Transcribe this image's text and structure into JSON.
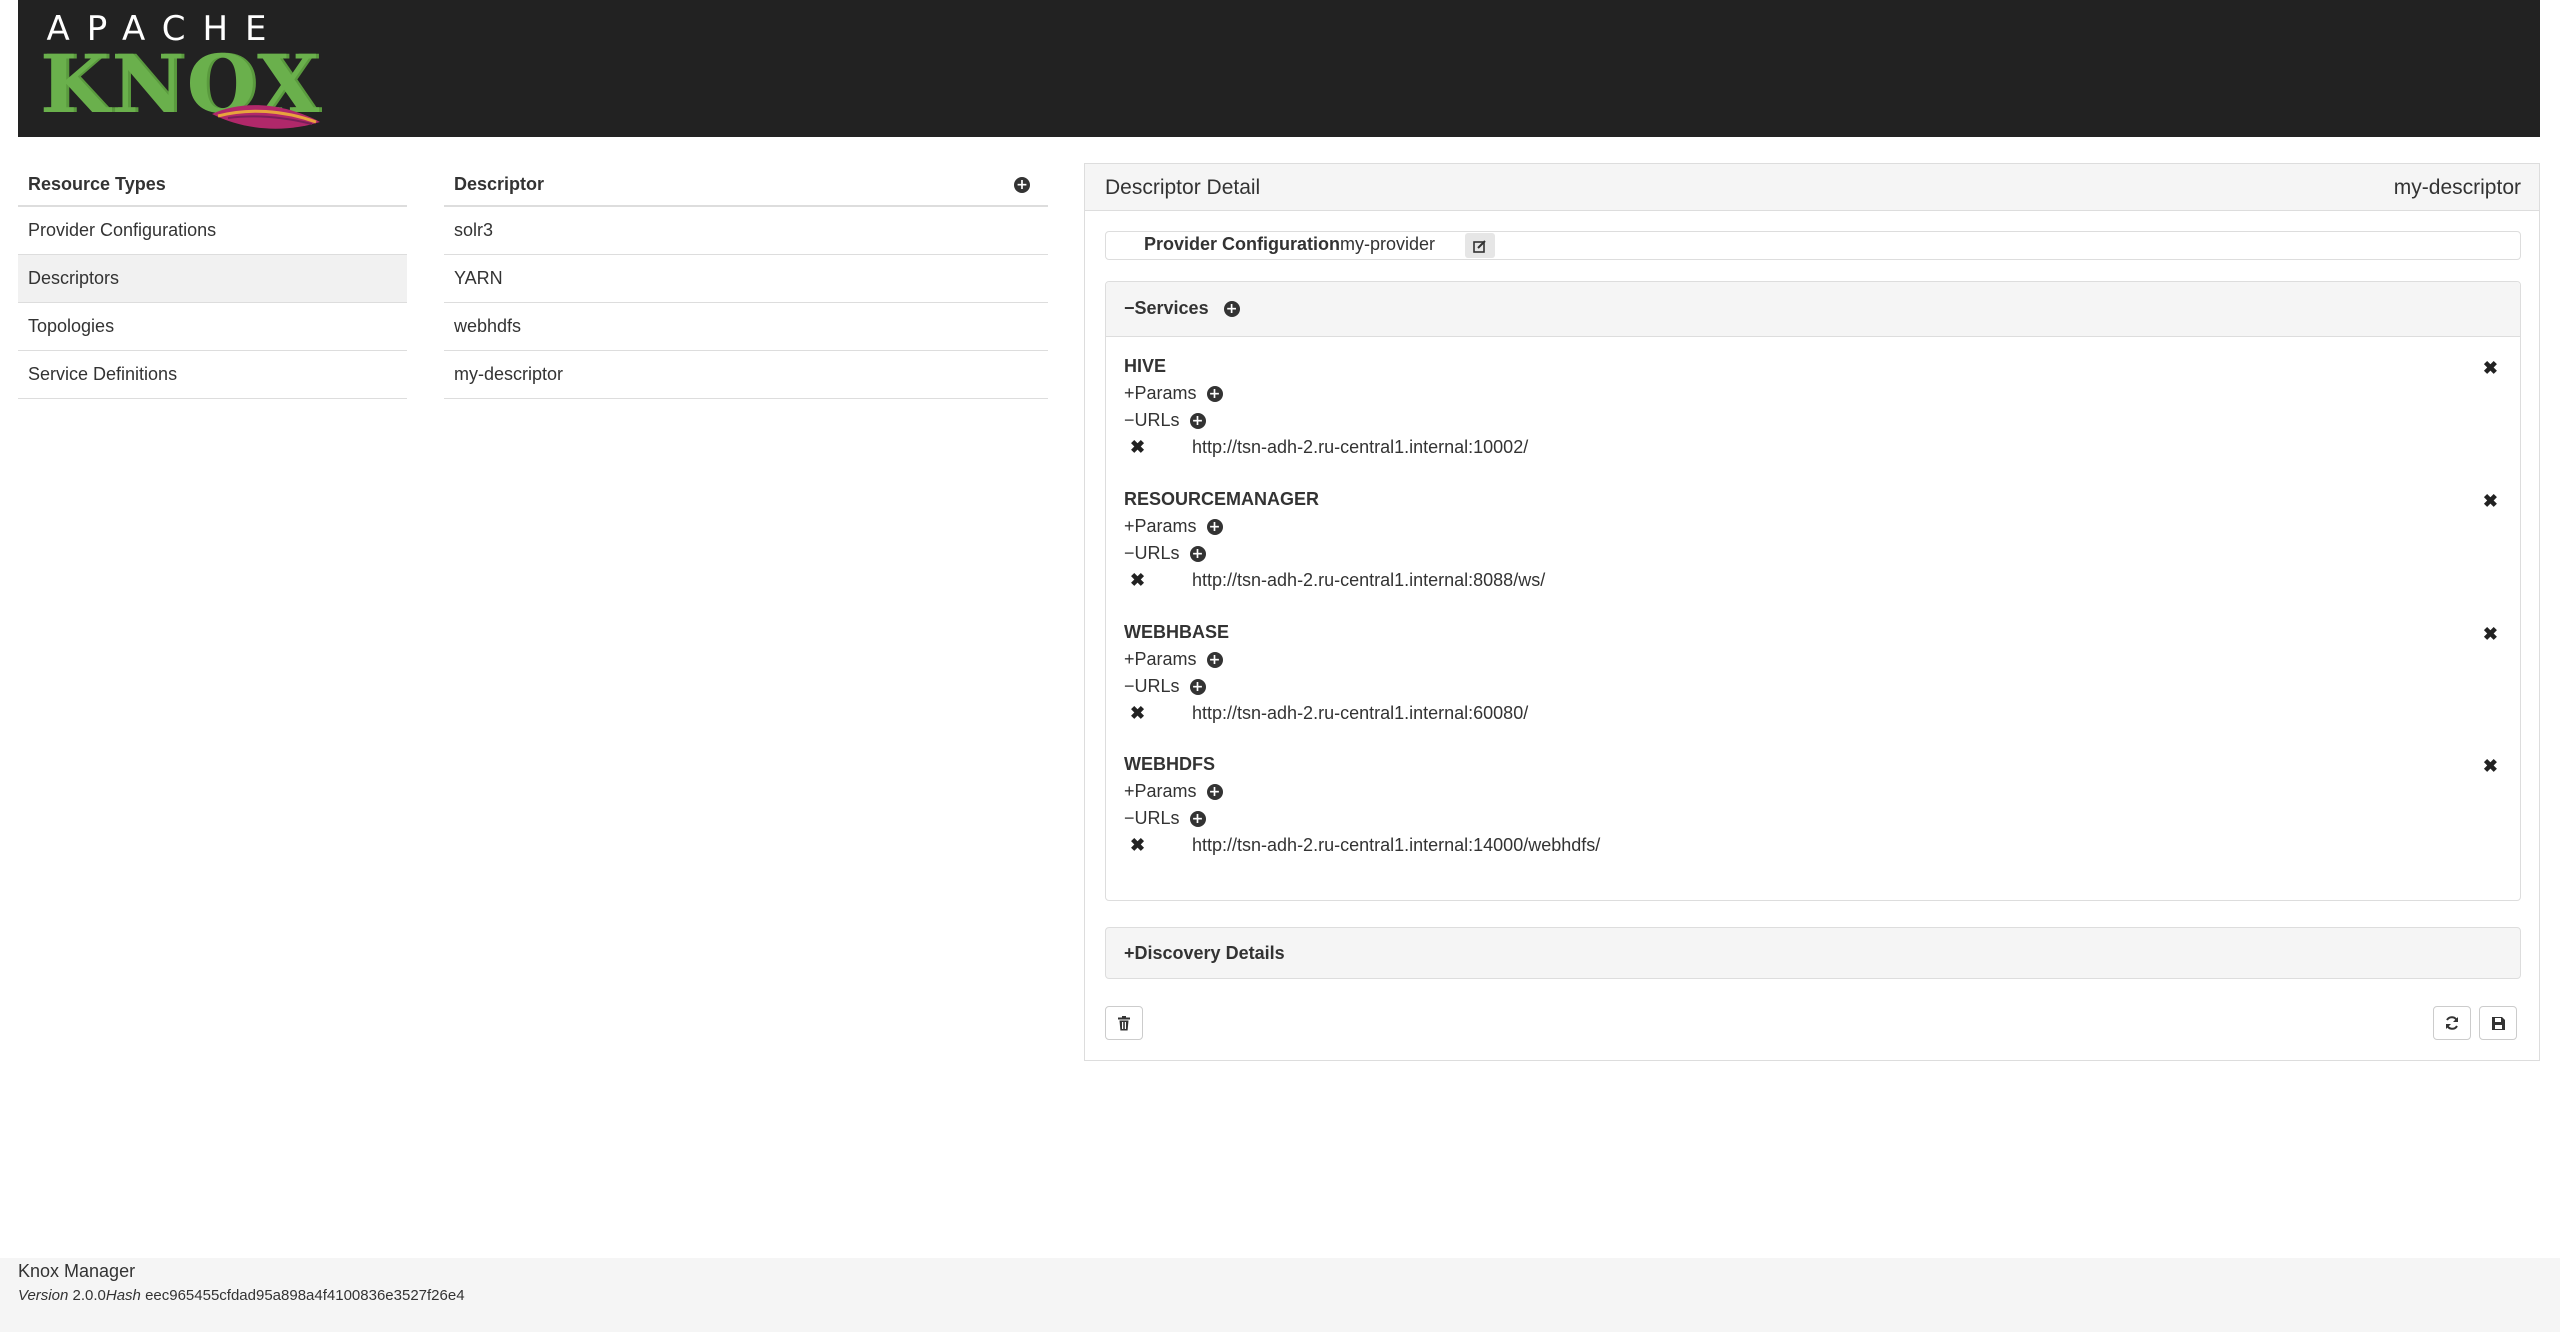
{
  "header": {
    "logo_top": "APACHE",
    "logo_main": "KNOX"
  },
  "resource_types": {
    "title": "Resource Types",
    "items": [
      {
        "label": "Provider Configurations"
      },
      {
        "label": "Descriptors"
      },
      {
        "label": "Topologies"
      },
      {
        "label": "Service Definitions"
      }
    ],
    "active": "Descriptors"
  },
  "descriptors": {
    "title": "Descriptor",
    "items": [
      {
        "label": "solr3"
      },
      {
        "label": "YARN"
      },
      {
        "label": "webhdfs"
      },
      {
        "label": "my-descriptor"
      }
    ]
  },
  "detail": {
    "title": "Descriptor Detail",
    "name": "my-descriptor",
    "provider_label": "Provider Configuration",
    "provider_value": "my-provider",
    "services_title": "−Services",
    "params_label": "+Params",
    "urls_label": "−URLs",
    "services": [
      {
        "name": "HIVE",
        "url": "http://tsn-adh-2.ru-central1.internal:10002/"
      },
      {
        "name": "RESOURCEMANAGER",
        "url": "http://tsn-adh-2.ru-central1.internal:8088/ws/"
      },
      {
        "name": "WEBHBASE",
        "url": "http://tsn-adh-2.ru-central1.internal:60080/"
      },
      {
        "name": "WEBHDFS",
        "url": "http://tsn-adh-2.ru-central1.internal:14000/webhdfs/"
      }
    ],
    "discovery_title": "+Discovery Details"
  },
  "footer": {
    "title": "Knox Manager",
    "version_label": "Version",
    "version": "2.0.0",
    "hash_label": "Hash",
    "hash": "eec965455cfdad95a898a4f4100836e3527f26e4"
  },
  "colors": {
    "header_bg": "#222222",
    "logo_green": "#6ab04c",
    "panel_bg": "#f5f5f5",
    "border": "#dddddd"
  }
}
